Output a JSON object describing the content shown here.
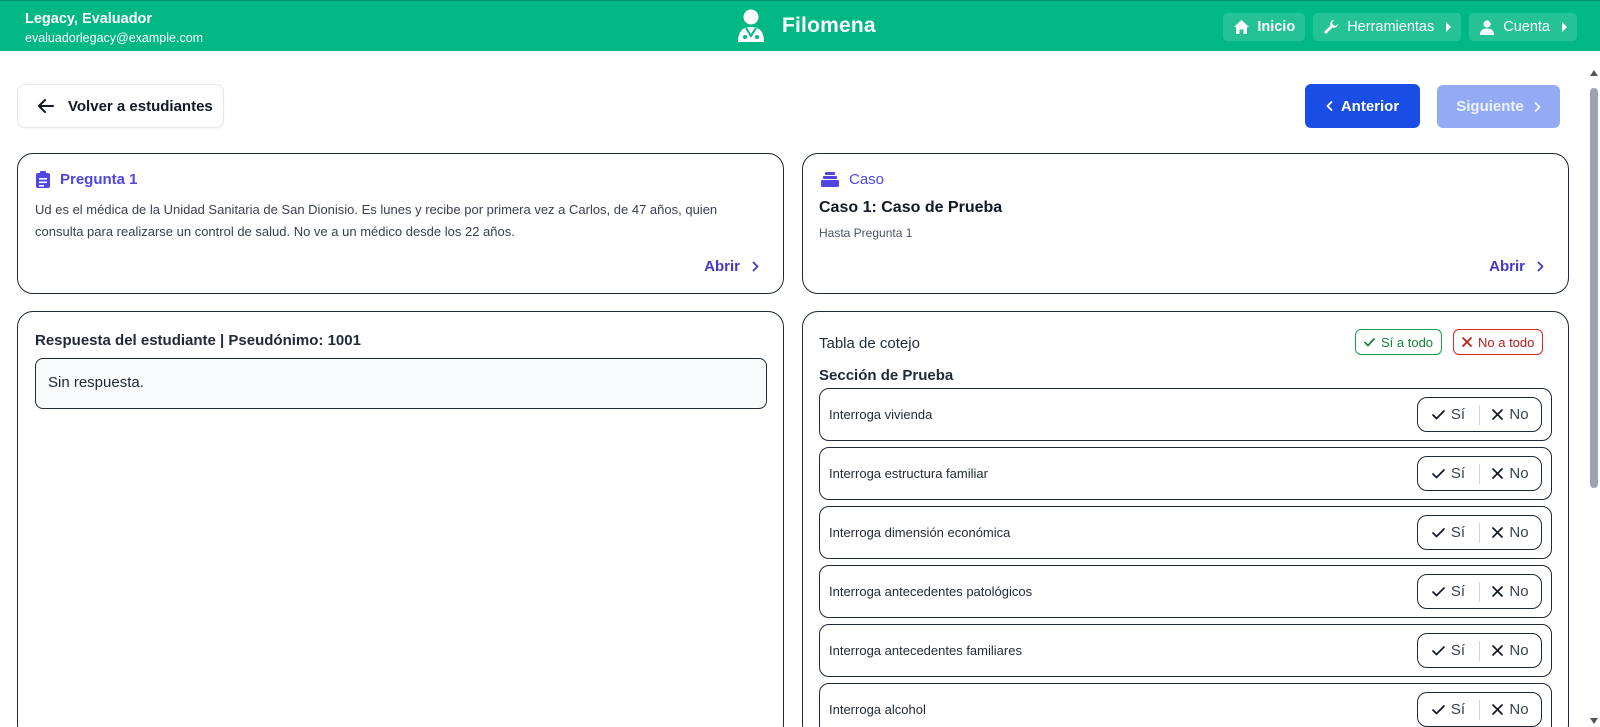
{
  "header": {
    "user_name": "Legacy, Evaluador",
    "user_email": "evaluadorlegacy@example.com",
    "brand": "Filomena",
    "nav": {
      "home": "Inicio",
      "tools": "Herramientas",
      "account": "Cuenta"
    }
  },
  "actions": {
    "back": "Volver a estudiantes",
    "prev": "Anterior",
    "next": "Siguiente"
  },
  "question": {
    "label": "Pregunta 1",
    "text": "Ud es el médica de la Unidad Sanitaria de San Dionisio. Es lunes y recibe por primera vez a Carlos, de 47 años, quien consulta para realizarse un control de salud. No ve a un médico desde los 22 años.",
    "open": "Abrir"
  },
  "case": {
    "label": "Caso",
    "title": "Caso 1: Caso de Prueba",
    "subtitle": "Hasta Pregunta 1",
    "open": "Abrir"
  },
  "answer": {
    "title": "Respuesta del estudiante | Pseudónimo: 1001",
    "value": "Sin respuesta."
  },
  "checklist": {
    "title": "Tabla de cotejo",
    "all_yes": "Sí a todo",
    "all_no": "No a todo",
    "section": "Sección de Prueba",
    "yes_label": "Sí",
    "no_label": "No",
    "items": [
      "Interroga vivienda",
      "Interroga estructura familiar",
      "Interroga dimensión económica",
      "Interroga antecedentes patológicos",
      "Interroga antecedentes familiares",
      "Interroga alcohol"
    ]
  },
  "colors": {
    "topbar": "#00b884",
    "primary": "#1a4de6",
    "accent": "#4f46e5"
  }
}
